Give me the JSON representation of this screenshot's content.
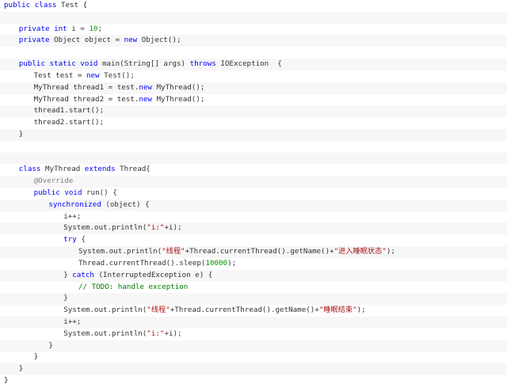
{
  "colors": {
    "keyword": "#0000ff",
    "number": "#009900",
    "string": "#a31515",
    "annotation": "#808080",
    "comment": "#008000",
    "text": "#333333",
    "stripe": "#f7f7f7"
  },
  "code": {
    "lines": [
      {
        "indent": 0,
        "tokens": [
          [
            "kw",
            "public"
          ],
          [
            "pl",
            " "
          ],
          [
            "kw",
            "class"
          ],
          [
            "pl",
            " Test {"
          ]
        ]
      },
      {
        "indent": 0,
        "tokens": []
      },
      {
        "indent": 4,
        "tokens": [
          [
            "kw",
            "private"
          ],
          [
            "pl",
            " "
          ],
          [
            "kw",
            "int"
          ],
          [
            "pl",
            " i = "
          ],
          [
            "num",
            "10"
          ],
          [
            "pl",
            ";"
          ]
        ]
      },
      {
        "indent": 4,
        "tokens": [
          [
            "kw",
            "private"
          ],
          [
            "pl",
            " Object object = "
          ],
          [
            "kw",
            "new"
          ],
          [
            "pl",
            " Object();"
          ]
        ]
      },
      {
        "indent": 0,
        "tokens": []
      },
      {
        "indent": 4,
        "tokens": [
          [
            "kw",
            "public"
          ],
          [
            "pl",
            " "
          ],
          [
            "kw",
            "static"
          ],
          [
            "pl",
            " "
          ],
          [
            "kw",
            "void"
          ],
          [
            "pl",
            " main(String[] args) "
          ],
          [
            "kw",
            "throws"
          ],
          [
            "pl",
            " IOException  {"
          ]
        ]
      },
      {
        "indent": 8,
        "tokens": [
          [
            "pl",
            "Test test = "
          ],
          [
            "kw",
            "new"
          ],
          [
            "pl",
            " Test();"
          ]
        ]
      },
      {
        "indent": 8,
        "tokens": [
          [
            "pl",
            "MyThread thread1 = test."
          ],
          [
            "kw",
            "new"
          ],
          [
            "pl",
            " MyThread();"
          ]
        ]
      },
      {
        "indent": 8,
        "tokens": [
          [
            "pl",
            "MyThread thread2 = test."
          ],
          [
            "kw",
            "new"
          ],
          [
            "pl",
            " MyThread();"
          ]
        ]
      },
      {
        "indent": 8,
        "tokens": [
          [
            "pl",
            "thread1.start();"
          ]
        ]
      },
      {
        "indent": 8,
        "tokens": [
          [
            "pl",
            "thread2.start();"
          ]
        ]
      },
      {
        "indent": 4,
        "tokens": [
          [
            "pl",
            "}"
          ]
        ]
      },
      {
        "indent": 0,
        "tokens": []
      },
      {
        "indent": 0,
        "tokens": []
      },
      {
        "indent": 4,
        "tokens": [
          [
            "kw",
            "class"
          ],
          [
            "pl",
            " MyThread "
          ],
          [
            "kw",
            "extends"
          ],
          [
            "pl",
            " Thread{"
          ]
        ]
      },
      {
        "indent": 8,
        "tokens": [
          [
            "ann",
            "@Override"
          ]
        ]
      },
      {
        "indent": 8,
        "tokens": [
          [
            "kw",
            "public"
          ],
          [
            "pl",
            " "
          ],
          [
            "kw",
            "void"
          ],
          [
            "pl",
            " run() {"
          ]
        ]
      },
      {
        "indent": 12,
        "tokens": [
          [
            "kw",
            "synchronized"
          ],
          [
            "pl",
            " (object) {"
          ]
        ]
      },
      {
        "indent": 16,
        "tokens": [
          [
            "pl",
            "i++;"
          ]
        ]
      },
      {
        "indent": 16,
        "tokens": [
          [
            "pl",
            "System.out.println("
          ],
          [
            "str",
            "\"i:\""
          ],
          [
            "pl",
            "+i);"
          ]
        ]
      },
      {
        "indent": 16,
        "tokens": [
          [
            "kw",
            "try"
          ],
          [
            "pl",
            " {"
          ]
        ]
      },
      {
        "indent": 20,
        "tokens": [
          [
            "pl",
            "System.out.println("
          ],
          [
            "str",
            "\"线程\""
          ],
          [
            "pl",
            "+Thread.currentThread().getName()+"
          ],
          [
            "str",
            "\"进入睡眠状态\""
          ],
          [
            "pl",
            ");"
          ]
        ]
      },
      {
        "indent": 20,
        "tokens": [
          [
            "pl",
            "Thread.currentThread().sleep("
          ],
          [
            "num",
            "10000"
          ],
          [
            "pl",
            ");"
          ]
        ]
      },
      {
        "indent": 16,
        "tokens": [
          [
            "pl",
            "} "
          ],
          [
            "kw",
            "catch"
          ],
          [
            "pl",
            " (InterruptedException e) {"
          ]
        ]
      },
      {
        "indent": 20,
        "tokens": [
          [
            "cmt",
            "// TODO: handle exception"
          ]
        ]
      },
      {
        "indent": 16,
        "tokens": [
          [
            "pl",
            "}"
          ]
        ]
      },
      {
        "indent": 16,
        "tokens": [
          [
            "pl",
            "System.out.println("
          ],
          [
            "str",
            "\"线程\""
          ],
          [
            "pl",
            "+Thread.currentThread().getName()+"
          ],
          [
            "str",
            "\"睡眠结束\""
          ],
          [
            "pl",
            ");"
          ]
        ]
      },
      {
        "indent": 16,
        "tokens": [
          [
            "pl",
            "i++;"
          ]
        ]
      },
      {
        "indent": 16,
        "tokens": [
          [
            "pl",
            "System.out.println("
          ],
          [
            "str",
            "\"i:\""
          ],
          [
            "pl",
            "+i);"
          ]
        ]
      },
      {
        "indent": 12,
        "tokens": [
          [
            "pl",
            "}"
          ]
        ]
      },
      {
        "indent": 8,
        "tokens": [
          [
            "pl",
            "}"
          ]
        ]
      },
      {
        "indent": 4,
        "tokens": [
          [
            "pl",
            "}"
          ]
        ]
      },
      {
        "indent": 0,
        "tokens": [
          [
            "pl",
            "}"
          ]
        ]
      }
    ]
  }
}
